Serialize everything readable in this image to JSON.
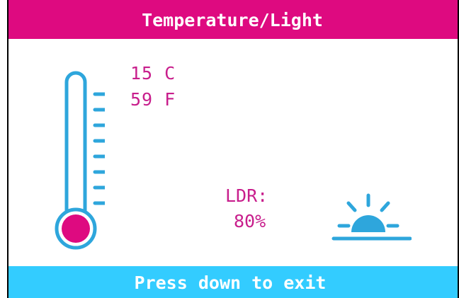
{
  "header": {
    "title": "Temperature/Light"
  },
  "temperature": {
    "celsius": "15 C",
    "fahrenheit": "59 F",
    "icon": "thermometer-icon"
  },
  "light": {
    "label": "LDR:",
    "value": "80%",
    "icon": "sun-icon"
  },
  "footer": {
    "hint": "Press down to exit"
  },
  "colors": {
    "title_bar": "#DE0A80",
    "footer_bar": "#33CCFF",
    "text_accent": "#C81E8C",
    "icon_blue": "#2EA6DC",
    "thermo_bulb": "#DE0A80"
  }
}
